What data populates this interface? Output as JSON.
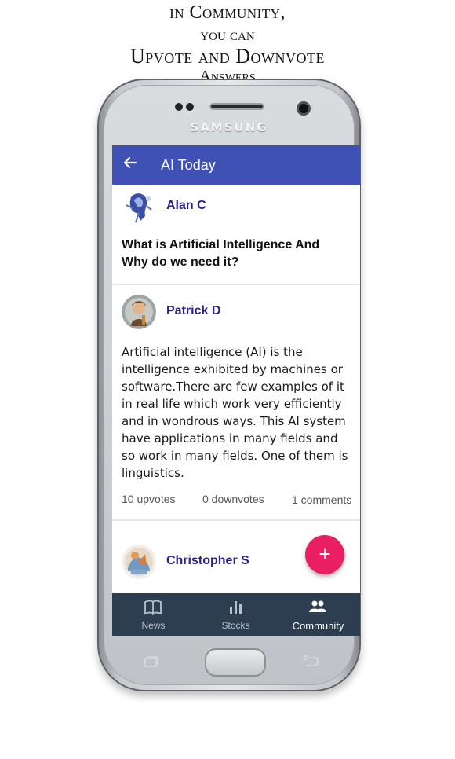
{
  "headline": {
    "line1": "in Community,",
    "line2": "you can",
    "line3": "Upvote and Downvote",
    "line4": "Answers"
  },
  "device": {
    "brand": "SAMSUNG"
  },
  "appbar": {
    "title": "AI Today",
    "back_icon": "arrow-left-icon"
  },
  "question_post": {
    "author": "Alan C",
    "question": "What is Artificial Intelligence And Why do we need it?"
  },
  "answer_post": {
    "author": "Patrick D",
    "text": "Artificial intelligence (AI) is the intelligence exhibited by machines or software.There are few examples of it in real life which work very efficiently and in wondrous ways. This AI system have applications in many fields and so work in many fields. One of them is linguistics.",
    "upvotes": "10 upvotes",
    "downvotes": "0 downvotes",
    "comments": "1 comments"
  },
  "next_post": {
    "author": "Christopher S"
  },
  "fab": {
    "label": "+",
    "icon": "add-icon"
  },
  "bottom_nav": {
    "items": [
      {
        "label": "News",
        "icon": "book-icon",
        "active": false
      },
      {
        "label": "Stocks",
        "icon": "bar-chart-icon",
        "active": false
      },
      {
        "label": "Community",
        "icon": "people-icon",
        "active": true
      }
    ]
  },
  "colors": {
    "appbar": "#3f51b5",
    "author_name": "#2b1f8c",
    "fab": "#e91e63",
    "bottom_nav": "#2d3e50"
  }
}
